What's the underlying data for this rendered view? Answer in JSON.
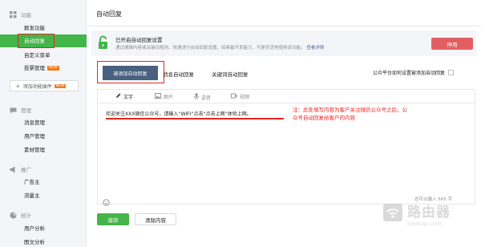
{
  "sidebar": {
    "sections": [
      {
        "title": "功能",
        "icon": "grid-icon",
        "items": [
          "群发功能",
          "自动回复",
          "自定义菜单",
          "投票管理"
        ]
      },
      {
        "title": "管理",
        "icon": "chat-icon",
        "items": [
          "消息管理",
          "用户管理",
          "素材管理"
        ]
      },
      {
        "title": "推广",
        "icon": "megaphone-icon",
        "items": [
          "广告主",
          "流量主"
        ]
      },
      {
        "title": "统计",
        "icon": "chart-icon",
        "items": [
          "用户分析",
          "图文分析"
        ]
      }
    ],
    "add_plugin_label": "添加功能插件",
    "new_badge": "NEW"
  },
  "main": {
    "page_title": "自动回复",
    "notice": {
      "title": "已开启自动回复设置",
      "desc": "通过编辑内容或关键词规则，快速进行自动回复设置。如具备开发能力，可更灵活地使用该功能。",
      "link": "查看详情",
      "disable_button": "停用"
    },
    "tabs": [
      "被添加自动回复",
      "消息自动回复",
      "关键词自动回复"
    ],
    "right_link": "公众平台如何设置被添加自动回复",
    "editor": {
      "tools": [
        "文字",
        "图片",
        "语音",
        "视频"
      ],
      "content": "欢迎关注XXX微信公众号，请输入“WIFI”点击“点击上网”体验上网。",
      "annotation": "注：此处填写内容为客户关注微信公众号之后，公众号自动回复给客户的内容",
      "char_count": "还可以输入 565 字"
    },
    "save_button": "保存",
    "clear_button": "清除内容"
  },
  "watermark": {
    "title": "路由器",
    "subtitle": "luyouqi.com"
  },
  "colors": {
    "green": "#44b549",
    "red": "#e8261f",
    "navy": "#4a6080",
    "disable": "#e15f63"
  }
}
